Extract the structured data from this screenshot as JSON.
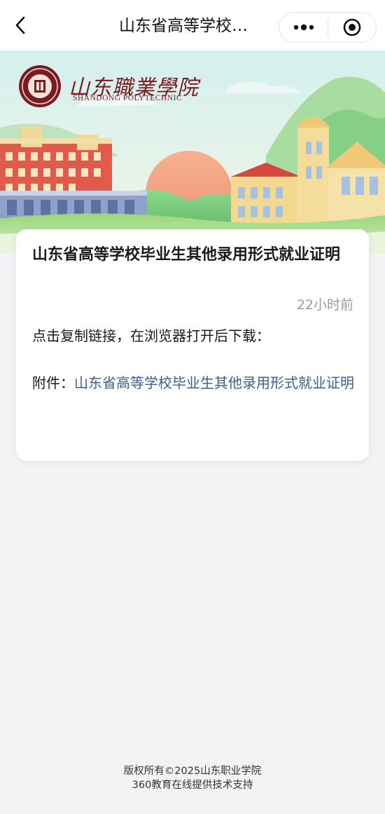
{
  "navbar": {
    "title": "山东省高等学校…",
    "back_icon": "chevron-left-icon",
    "more_icon": "more-dots-icon",
    "close_icon": "target-circle-icon"
  },
  "banner": {
    "school_name_cn": "山东職業學院",
    "school_name_en": "SHANDONG POLYTECHNIC",
    "colors": {
      "sky": "#cdeef0",
      "sun": "#f4a57d",
      "hill_green": "#7ccf7a",
      "brand_red": "#7a1b22"
    }
  },
  "article": {
    "title": "山东省高等学校毕业生其他录用形式就业证明",
    "time": "22小时前",
    "instruction": "点击复制链接，在浏览器打开后下载：",
    "attachment_label": "附件：",
    "attachment_link": "山东省高等学校毕业生其他录用形式就业证明"
  },
  "footer": {
    "copyright": "版权所有©2025山东职业学院",
    "support": "360教育在线提供技术支持"
  }
}
